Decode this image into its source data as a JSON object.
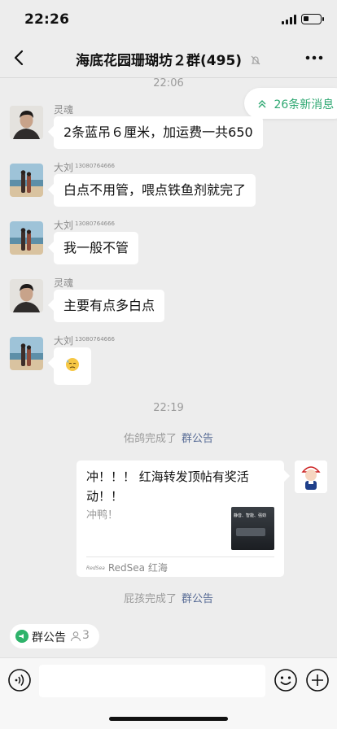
{
  "status_bar": {
    "time": "22:26",
    "battery_level_percent": 35
  },
  "nav": {
    "title": "海底花园珊瑚坊２群(495)",
    "back_icon": "chevron-left-icon",
    "mute_icon": "bell-off-icon",
    "more_icon": "ellipsis-icon"
  },
  "new_messages": {
    "label": "26条新消息",
    "icon": "double-chevron-up-icon"
  },
  "messages": [
    {
      "sender": "灵魂",
      "sender_id": "",
      "text": "2条蓝吊６厘米，加运费一共650",
      "avatar": "man-avatar"
    },
    {
      "sender": "大刘",
      "sender_id": "13080764666",
      "text": "白点不用管，喂点铁鱼剂就完了",
      "avatar": "beach-couple-avatar"
    },
    {
      "sender": "大刘",
      "sender_id": "13080764666",
      "text": "我一般不管",
      "avatar": "beach-couple-avatar"
    },
    {
      "sender": "灵魂",
      "sender_id": "",
      "text": "主要有点多白点",
      "avatar": "man-avatar"
    },
    {
      "sender": "大刘",
      "sender_id": "13080764666",
      "text": "😓",
      "avatar": "beach-couple-avatar"
    }
  ],
  "timestamps": {
    "first": "22:06",
    "second": "22:19"
  },
  "system_notices": [
    {
      "who": "佑鸽完成了",
      "link": "群公告"
    },
    {
      "who": "屁孩完成了",
      "link": "群公告"
    }
  ],
  "card": {
    "title": "冲！！！ 红海转发顶帖有奖活动！！",
    "description": "冲鸭！",
    "thumb_text": "静音、智能、强劲",
    "source_logo": "RedSea",
    "source": "RedSea 红海"
  },
  "pinned": {
    "label": "群公告",
    "count": "3",
    "icon": "announcement-icon"
  },
  "input": {
    "value": "",
    "placeholder": ""
  },
  "colors": {
    "background": "#ededed",
    "accent_green": "#2fa872",
    "link_blue": "#576b95"
  }
}
